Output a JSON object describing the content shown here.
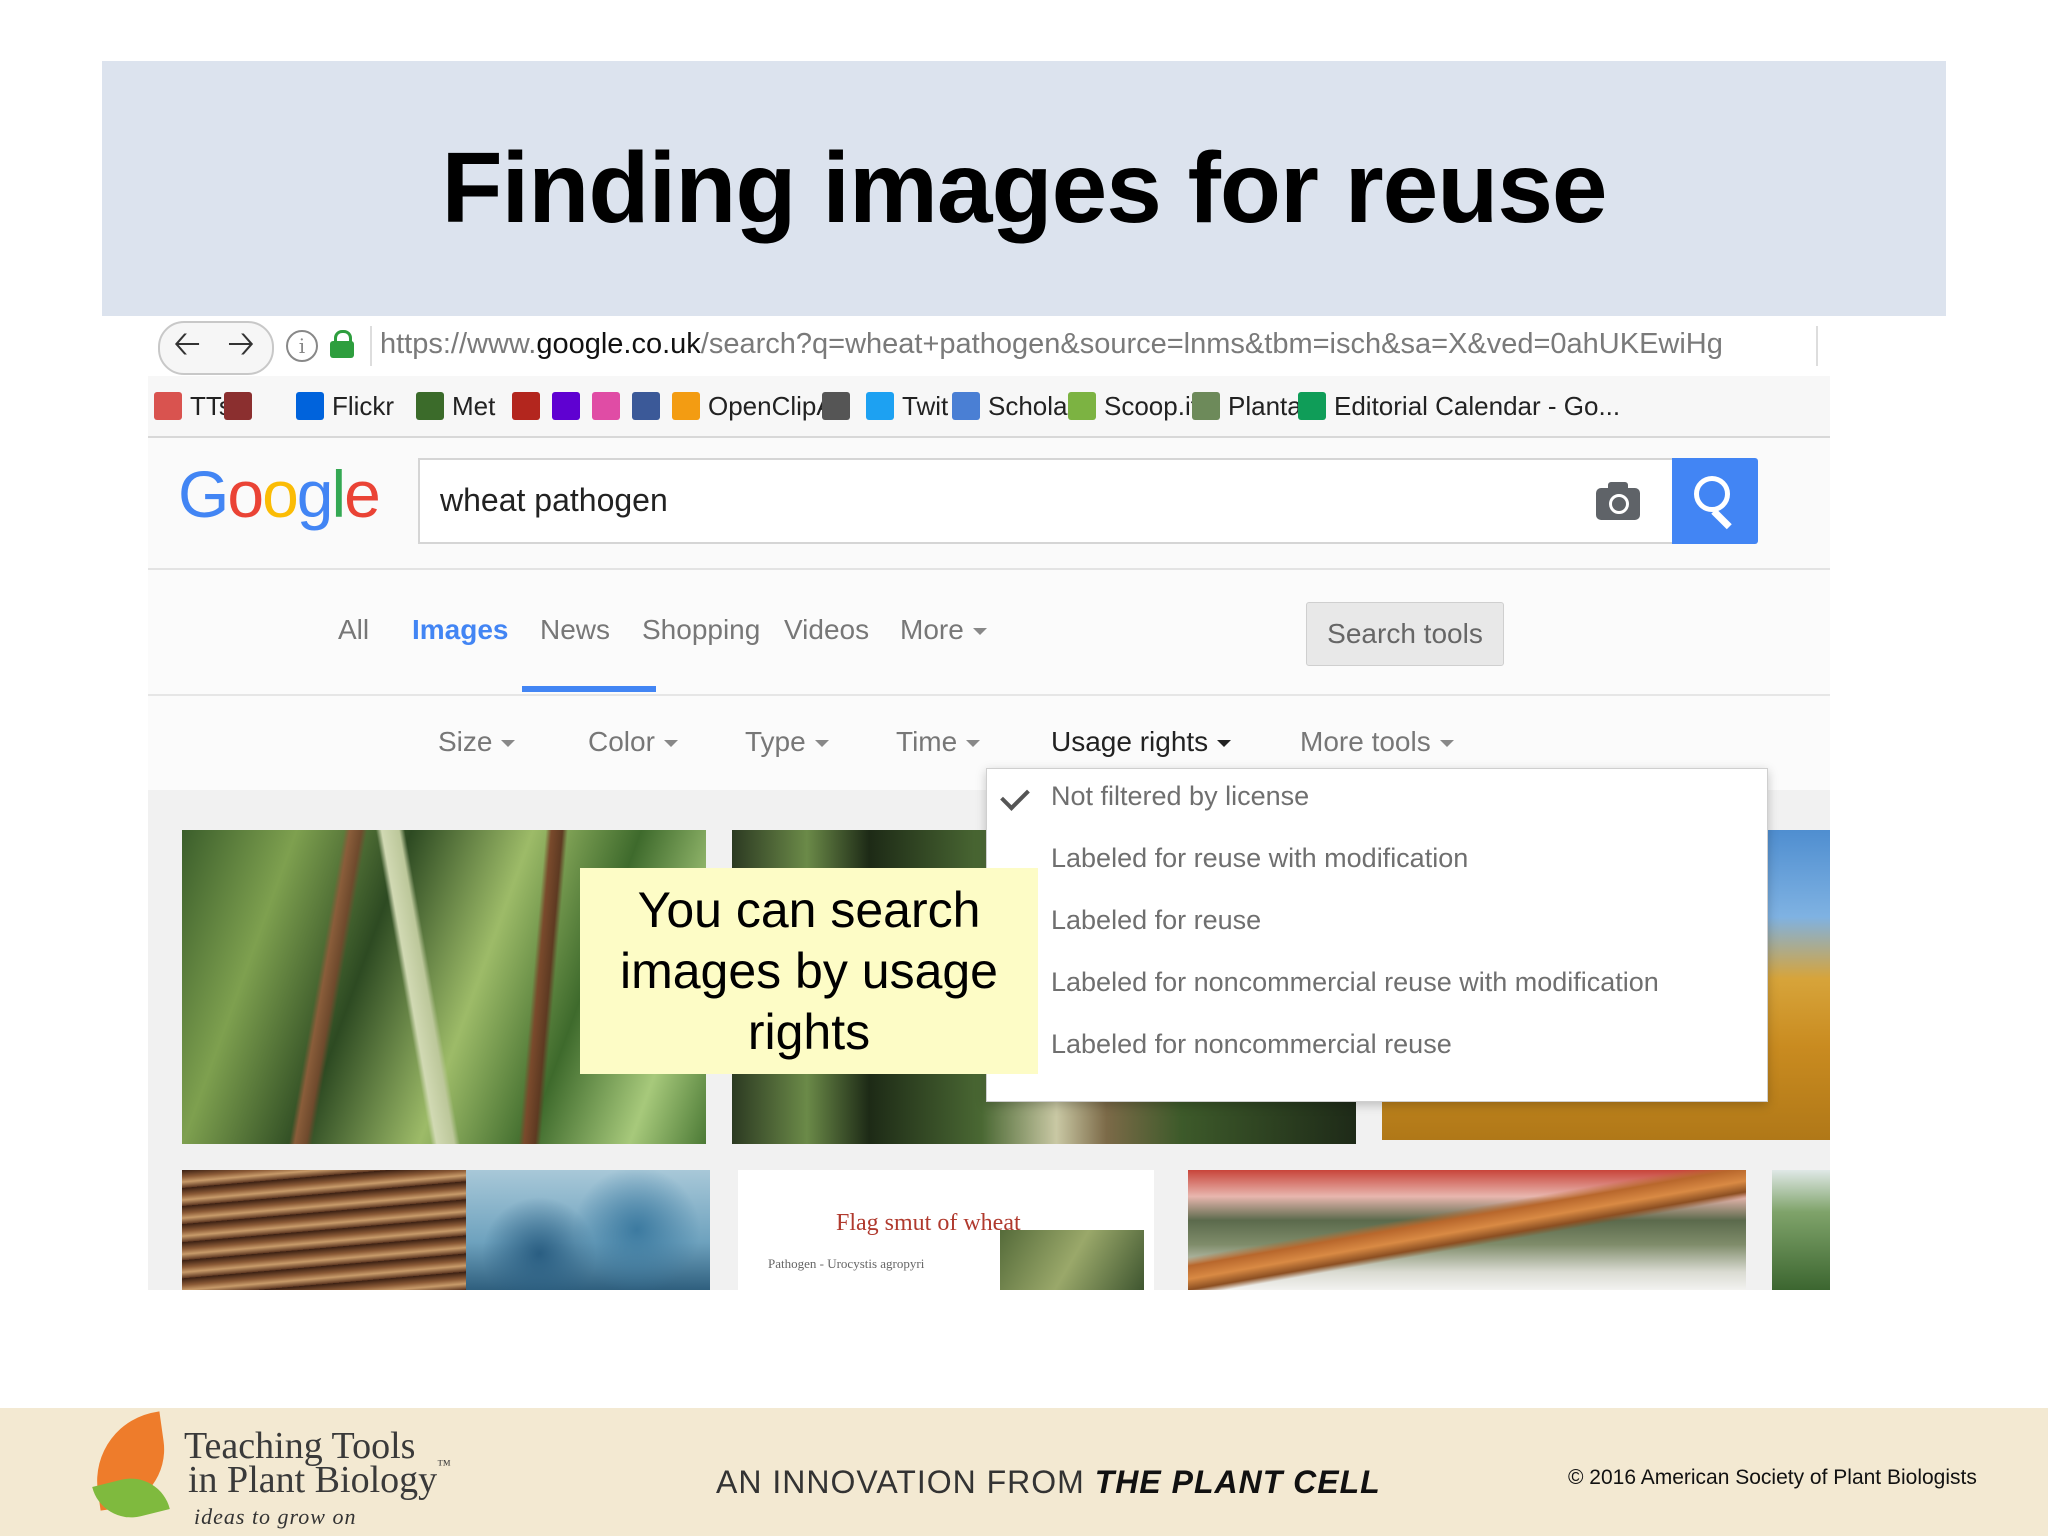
{
  "slide": {
    "title": "Finding images for reuse",
    "callout": "You can search images by usage rights"
  },
  "browser": {
    "url_prefix": "https://www.",
    "url_domain": "google.co.uk",
    "url_rest": "/search?q=wheat+pathogen&source=lnms&tbm=isch&sa=X&ved=0ahUKEwiHg",
    "back_icon": "arrow-left",
    "forward_icon": "arrow-right",
    "bookmarks": [
      {
        "label": "TTs",
        "icon": "bookmark-icon",
        "color": "#d9534f"
      },
      {
        "label": "",
        "icon": "bookmark-icon",
        "color": "#8b2f2f"
      },
      {
        "label": "Flickr",
        "icon": "flickr-icon",
        "color": "#0063dc"
      },
      {
        "label": "Met",
        "icon": "met-icon",
        "color": "#3b6b2a"
      },
      {
        "label": "",
        "icon": "bookmark-icon",
        "color": "#b3261e"
      },
      {
        "label": "",
        "icon": "yahoo-icon",
        "color": "#5f01d1"
      },
      {
        "label": "",
        "icon": "bookmark-icon",
        "color": "#e04ca5"
      },
      {
        "label": "",
        "icon": "facebook-icon",
        "color": "#3b5998"
      },
      {
        "label": "OpenClipArt",
        "icon": "openclipart-icon",
        "color": "#f39c12"
      },
      {
        "label": "",
        "icon": "sd-icon",
        "color": "#555555"
      },
      {
        "label": "Twit",
        "icon": "twitter-icon",
        "color": "#1da1f2"
      },
      {
        "label": "Scholar",
        "icon": "scholar-icon",
        "color": "#4a7fd4"
      },
      {
        "label": "Scoop.it",
        "icon": "scoopit-icon",
        "color": "#7cb342"
      },
      {
        "label": "Plantae",
        "icon": "plantae-icon",
        "color": "#6d8a5a"
      },
      {
        "label": "Editorial Calendar - Go...",
        "icon": "sheets-icon",
        "color": "#0f9d58"
      }
    ]
  },
  "google": {
    "logo": [
      "G",
      "o",
      "o",
      "g",
      "l",
      "e"
    ],
    "logo_colors": [
      "#4285f4",
      "#ea4335",
      "#fbbc05",
      "#4285f4",
      "#34a853",
      "#ea4335"
    ],
    "query": "wheat pathogen",
    "tabs": [
      "All",
      "Images",
      "News",
      "Shopping",
      "Videos",
      "More"
    ],
    "active_tab": "Images",
    "search_tools": "Search tools",
    "tools": [
      "Size",
      "Color",
      "Type",
      "Time",
      "Usage rights",
      "More tools"
    ],
    "usage_rights_options": [
      "Not filtered by license",
      "Labeled for reuse with modification",
      "Labeled for reuse",
      "Labeled for noncommercial reuse with modification",
      "Labeled for noncommercial reuse"
    ],
    "selected_option": "Not filtered by license",
    "result_text": {
      "flag_smut_title": "Flag smut of wheat",
      "flag_smut_sub": "Pathogen - Urocystis agropyri"
    },
    "accent": "#4285f4"
  },
  "footer": {
    "brand_line1": "Teaching Tools",
    "brand_line2": "in Plant Biology",
    "trademark": "™",
    "tagline": "ideas to grow on",
    "innovation_prefix": "AN INNOVATION FROM ",
    "innovation_brand": "THE PLANT CELL",
    "copyright": "©  2016 American Society of Plant Biologists"
  }
}
